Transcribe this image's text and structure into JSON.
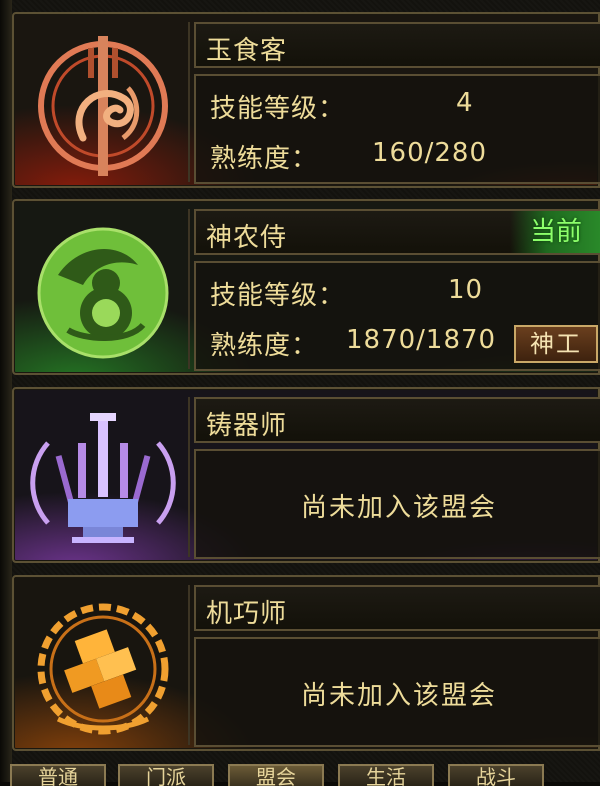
{
  "labels": {
    "skill_level": "技能等级：",
    "proficiency": "熟练度："
  },
  "professions": [
    {
      "name": "玉食客",
      "icon": "fish-emblem-icon",
      "level": "4",
      "proficiency": "160/280",
      "accent": "#b83012"
    },
    {
      "name": "神农侍",
      "icon": "herb-gourd-emblem-icon",
      "level": "10",
      "proficiency": "1870/1870",
      "current_tag": "当前",
      "action_button": "神工",
      "accent": "#2f8f2f"
    },
    {
      "name": "铸器师",
      "icon": "forge-anvil-emblem-icon",
      "status": "尚未加入该盟会",
      "accent": "#8a45b8"
    },
    {
      "name": "机巧师",
      "icon": "gear-puzzle-emblem-icon",
      "status": "尚未加入该盟会",
      "accent": "#d07010"
    }
  ],
  "tabs": [
    "普通",
    "门派",
    "盟会",
    "生活",
    "战斗"
  ],
  "active_tab_index": 2,
  "colors": {
    "text": "#eedc9a",
    "border": "#5a4e33",
    "current": "#8cff6a"
  }
}
